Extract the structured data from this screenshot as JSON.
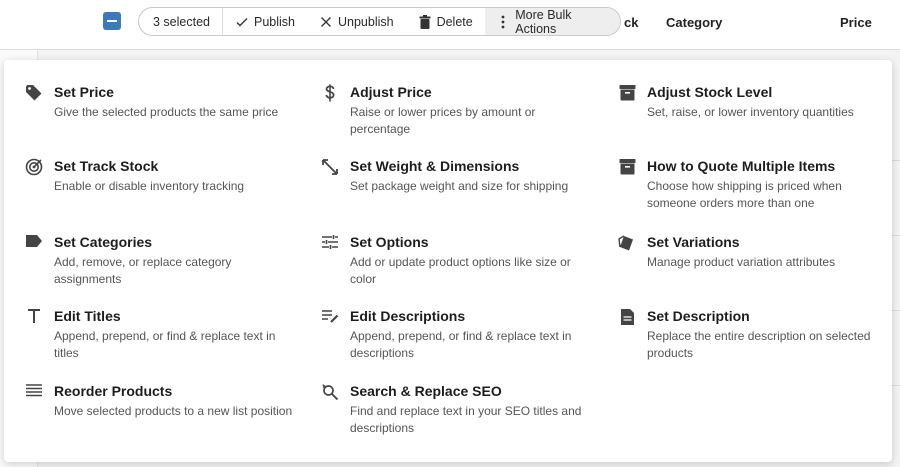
{
  "header": {
    "selected_label": "3 selected",
    "publish_label": "Publish",
    "unpublish_label": "Unpublish",
    "delete_label": "Delete",
    "more_label": "More Bulk Actions",
    "col_stock_fragment": "ck",
    "col_category": "Category",
    "col_price": "Price"
  },
  "colors": {
    "accent": "#3c7ab8"
  },
  "menu": [
    {
      "icon": "tag-icon",
      "title": "Set Price",
      "desc": "Give the selected products the same price"
    },
    {
      "icon": "dollar-icon",
      "title": "Adjust Price",
      "desc": "Raise or lower prices by amount or percentage"
    },
    {
      "icon": "archive-icon",
      "title": "Adjust Stock Level",
      "desc": "Set, raise, or lower inventory quantities"
    },
    {
      "icon": "target-icon",
      "title": "Set Track Stock",
      "desc": "Enable or disable inventory tracking"
    },
    {
      "icon": "resize-icon",
      "title": "Set Weight & Dimensions",
      "desc": "Set package weight and size for shipping"
    },
    {
      "icon": "archive-icon",
      "title": "How to Quote Multiple Items",
      "desc": "Choose how shipping is priced when someone orders more than one"
    },
    {
      "icon": "label-icon",
      "title": "Set Categories",
      "desc": "Add, remove, or replace category assignments"
    },
    {
      "icon": "tune-icon",
      "title": "Set Options",
      "desc": "Add or update product options like size or color"
    },
    {
      "icon": "style-icon",
      "title": "Set Variations",
      "desc": "Manage product variation attributes"
    },
    {
      "icon": "text-icon",
      "title": "Edit Titles",
      "desc": "Append, prepend, or find & replace text in titles"
    },
    {
      "icon": "edit-note-icon",
      "title": "Edit Descriptions",
      "desc": "Append, prepend, or find & replace text in descriptions"
    },
    {
      "icon": "document-icon",
      "title": "Set Description",
      "desc": "Replace the entire description on selected products"
    },
    {
      "icon": "reorder-icon",
      "title": "Reorder Products",
      "desc": "Move selected products to a new list position"
    },
    {
      "icon": "find-replace-icon",
      "title": "Search & Replace SEO",
      "desc": "Find and replace text in your SEO titles and descriptions"
    }
  ]
}
